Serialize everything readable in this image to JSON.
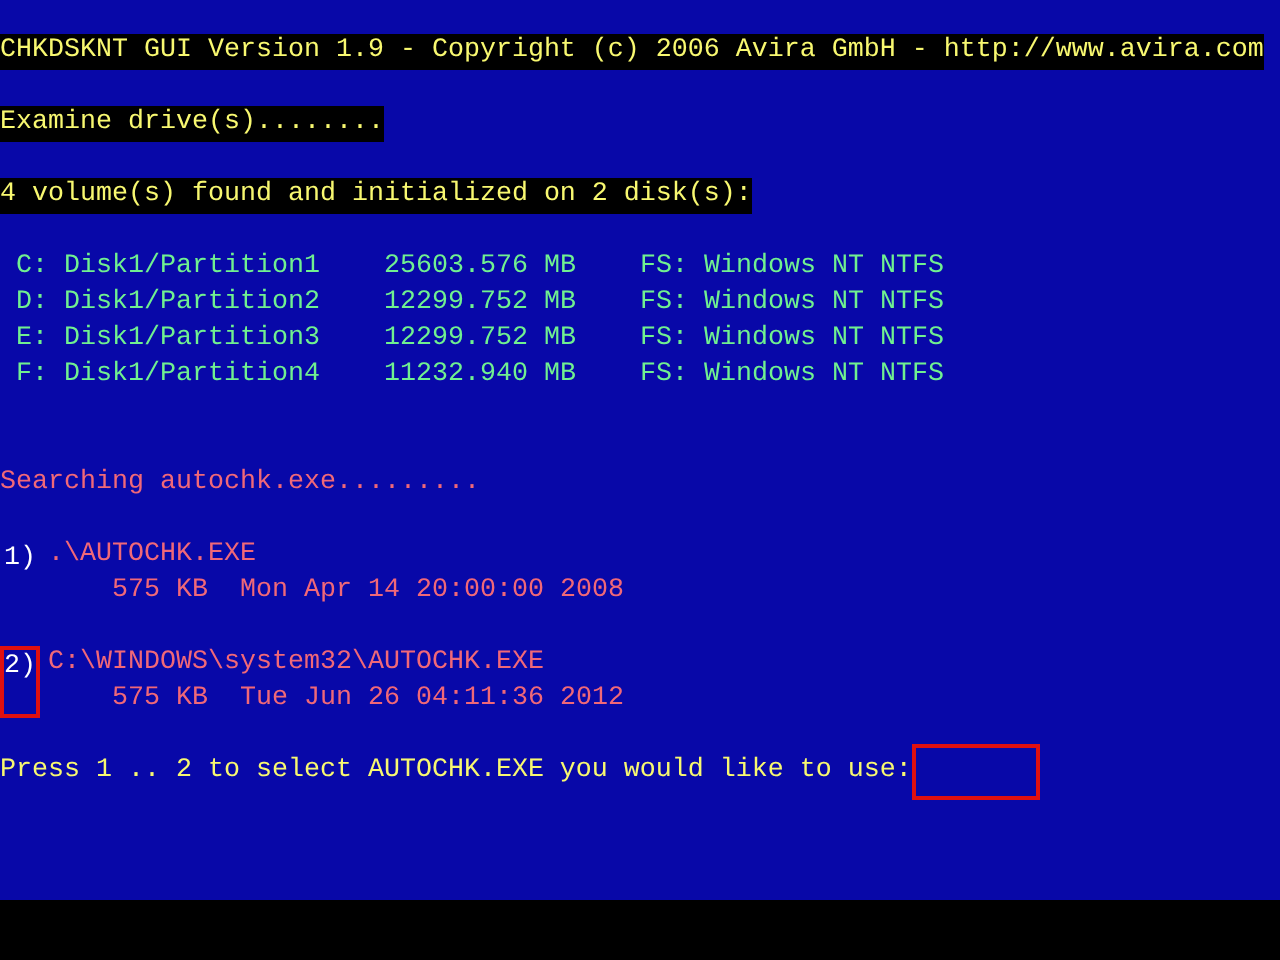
{
  "header": {
    "title": "CHKDSKNT GUI Version 1.9 - Copyright (c) 2006 Avira GmbH - http://www.avira.com",
    "status": "Examine drive(s)........",
    "volumes_found": "4 volume(s) found and initialized on 2 disk(s):"
  },
  "volumes": [
    {
      "drive": "C:",
      "path": "Disk1/Partition1",
      "size": "25603.576 MB",
      "fs": "FS: Windows NT NTFS"
    },
    {
      "drive": "D:",
      "path": "Disk1/Partition2",
      "size": "12299.752 MB",
      "fs": "FS: Windows NT NTFS"
    },
    {
      "drive": "E:",
      "path": "Disk1/Partition3",
      "size": "12299.752 MB",
      "fs": "FS: Windows NT NTFS"
    },
    {
      "drive": "F:",
      "path": "Disk1/Partition4",
      "size": "11232.940 MB",
      "fs": "FS: Windows NT NTFS"
    }
  ],
  "search": {
    "status": "Searching autochk.exe........."
  },
  "candidates": [
    {
      "number": "1)",
      "path": ".\\AUTOCHK.EXE",
      "details": "575 KB  Mon Apr 14 20:00:00 2008",
      "highlighted": false
    },
    {
      "number": "2)",
      "path": "C:\\WINDOWS\\system32\\AUTOCHK.EXE",
      "details": "575 KB  Tue Jun 26 04:11:36 2012",
      "highlighted": true
    }
  ],
  "prompt": {
    "text": "Press 1 .. 2 to select AUTOCHK.EXE you would like to use:",
    "input_highlighted": true
  }
}
